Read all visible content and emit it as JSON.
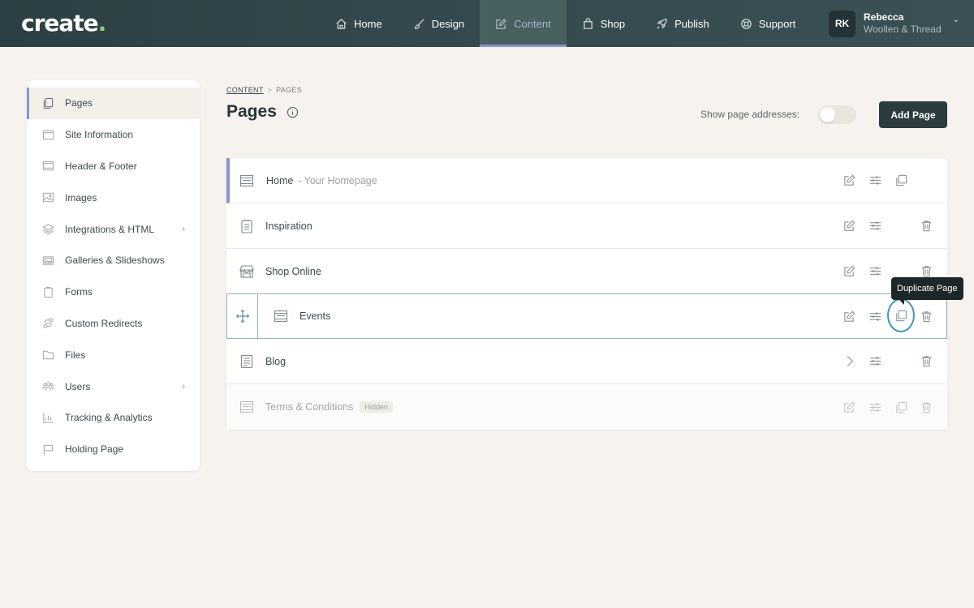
{
  "app": {
    "logo_text": "create",
    "logo_dot": ".",
    "brand_accent": "#8fd16a"
  },
  "nav": {
    "items": [
      {
        "label": "Home",
        "icon": "home-icon"
      },
      {
        "label": "Design",
        "icon": "brush-icon"
      },
      {
        "label": "Content",
        "icon": "edit-icon",
        "active": true
      },
      {
        "label": "Shop",
        "icon": "bag-icon"
      },
      {
        "label": "Publish",
        "icon": "rocket-icon"
      },
      {
        "label": "Support",
        "icon": "lifebuoy-icon"
      }
    ]
  },
  "user": {
    "initials": "RK",
    "name": "Rebecca",
    "org": "Woollen & Thread",
    "caret": "⌄"
  },
  "sidebar": {
    "items": [
      {
        "label": "Pages",
        "icon": "pages-icon",
        "active": true
      },
      {
        "label": "Site Information",
        "icon": "window-icon"
      },
      {
        "label": "Header & Footer",
        "icon": "header-footer-icon"
      },
      {
        "label": "Images",
        "icon": "image-icon"
      },
      {
        "label": "Integrations & HTML",
        "icon": "layers-icon",
        "chevron": "›"
      },
      {
        "label": "Galleries & Slideshows",
        "icon": "gallery-icon"
      },
      {
        "label": "Forms",
        "icon": "clipboard-icon"
      },
      {
        "label": "Custom Redirects",
        "icon": "redirect-icon"
      },
      {
        "label": "Files",
        "icon": "folder-icon"
      },
      {
        "label": "Users",
        "icon": "users-icon",
        "chevron": "›"
      },
      {
        "label": "Tracking & Analytics",
        "icon": "chart-icon"
      },
      {
        "label": "Holding Page",
        "icon": "flag-icon"
      }
    ]
  },
  "main": {
    "breadcrumb": {
      "parent": "CONTENT",
      "separator": ">",
      "current": "PAGES"
    },
    "title": "Pages",
    "show_addresses_label": "Show page addresses:",
    "show_addresses_on": false,
    "add_page_label": "Add Page"
  },
  "pages": [
    {
      "title": "Home",
      "subtitle": "- Your Homepage",
      "icon": "page-layout-icon"
    },
    {
      "title": "Inspiration",
      "icon": "notepad-icon"
    },
    {
      "title": "Shop Online",
      "icon": "store-icon"
    },
    {
      "title": "Events",
      "icon": "page-layout-icon",
      "selected": true
    },
    {
      "title": "Blog",
      "icon": "blog-icon"
    },
    {
      "title": "Terms & Conditions",
      "icon": "page-layout-icon",
      "badge": "Hidden"
    }
  ],
  "tooltip": {
    "text": "Duplicate Page"
  }
}
